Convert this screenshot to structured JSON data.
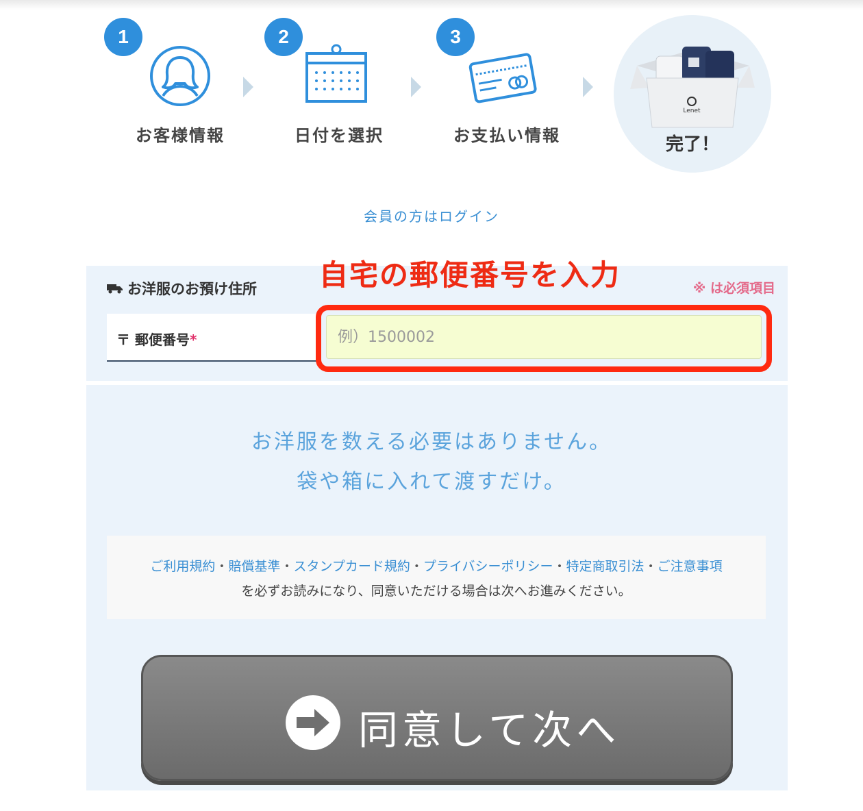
{
  "steps": [
    {
      "number": "1",
      "label": "お客様情報",
      "icon": "person-icon"
    },
    {
      "number": "2",
      "label": "日付を選択",
      "icon": "calendar-icon"
    },
    {
      "number": "3",
      "label": "お支払い情報",
      "icon": "credit-card-icon"
    },
    {
      "label": "完了！",
      "icon": "box-icon",
      "box_brand": "Lenet"
    }
  ],
  "login_link": "会員の方はログイン",
  "address_section": {
    "title": "お洋服のお預け住所",
    "required_note": "※ は必須項目",
    "annotation": "自宅の郵便番号を入力",
    "zip_label": "〒 郵便番号",
    "required_mark": "*",
    "zip_placeholder": "例）1500002",
    "zip_value": ""
  },
  "message": {
    "line1": "お洋服を数える必要はありません。",
    "line2": "袋や箱に入れて渡すだけ。"
  },
  "terms": {
    "links": [
      "ご利用規約",
      "賠償基準",
      "スタンプカード規約",
      "プライバシーポリシー",
      "特定商取引法",
      "ご注意事項"
    ],
    "separator": "・",
    "note": "を必ずお読みになり、同意いただける場合は次へお進みください。"
  },
  "next_button": {
    "label": "同意して次へ",
    "icon": "arrow-right-icon"
  },
  "colors": {
    "accent": "#2f8fdc",
    "link": "#3a8fd3",
    "panel_bg": "#ebf3fb",
    "annotation": "#ee2b14",
    "input_bg": "#f6fdd2",
    "button": "#777777"
  }
}
